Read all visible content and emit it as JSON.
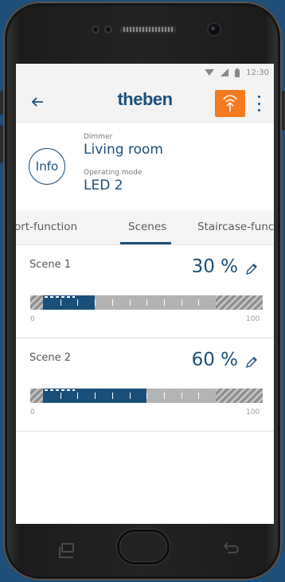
{
  "status": {
    "time": "12:30"
  },
  "appbar": {
    "brand": "theben"
  },
  "device": {
    "type_label": "Dimmer",
    "name": "Living room",
    "mode_label": "Operating mode",
    "mode": "LED 2",
    "info_label": "Info"
  },
  "tabs": [
    {
      "label": "ort-function",
      "active": false
    },
    {
      "label": "Scenes",
      "active": true
    },
    {
      "label": "Staircase-func",
      "active": false
    }
  ],
  "scenes": [
    {
      "name": "Scene 1",
      "value_text": "30 %",
      "level_percent": 30,
      "min": "0",
      "max": "100"
    },
    {
      "name": "Scene 2",
      "value_text": "60 %",
      "level_percent": 60,
      "min": "0",
      "max": "100"
    }
  ],
  "colors": {
    "brand": "#1a4f7a",
    "accent": "#f47a20",
    "background": "#1f4f78"
  },
  "icons": {
    "back": "arrow-left-icon",
    "remote": "antenna-upload-icon",
    "menu": "more-vertical-icon",
    "edit": "pencil-icon"
  }
}
